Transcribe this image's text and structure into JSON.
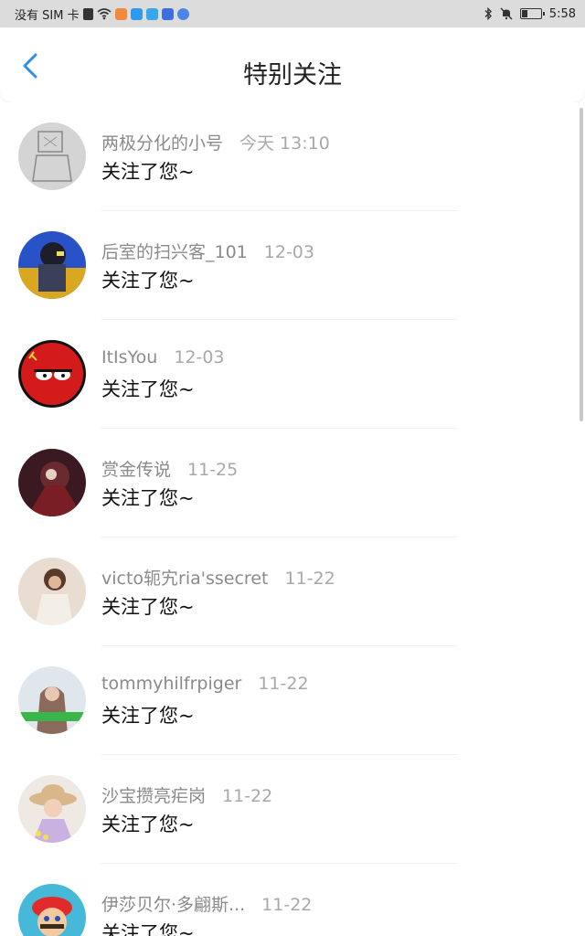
{
  "status": {
    "carrier": "没有 SIM 卡",
    "time": "5:58"
  },
  "header": {
    "title": "特别关注"
  },
  "items": [
    {
      "name": "两极分化的小号",
      "time": "今天 13:10",
      "message": "关注了您~"
    },
    {
      "name": "后室的扫兴客_101",
      "time": "12-03",
      "message": "关注了您~"
    },
    {
      "name": "ItIsYou",
      "time": "12-03",
      "message": "关注了您~"
    },
    {
      "name": "赏金传说",
      "time": "11-25",
      "message": "关注了您~"
    },
    {
      "name": "victo轭宄ria'ssecret",
      "time": "11-22",
      "message": "关注了您~"
    },
    {
      "name": "tommyhilfrpiger",
      "time": "11-22",
      "message": "关注了您~"
    },
    {
      "name": "沙宝攒亮疟岗",
      "time": "11-22",
      "message": "关注了您~"
    },
    {
      "name": "伊莎贝尔·多翩斯...",
      "time": "11-22",
      "message": "关注了您~"
    }
  ],
  "colors": {
    "accent": "#2f8fe6",
    "status_bar": "#dcdcdc"
  }
}
